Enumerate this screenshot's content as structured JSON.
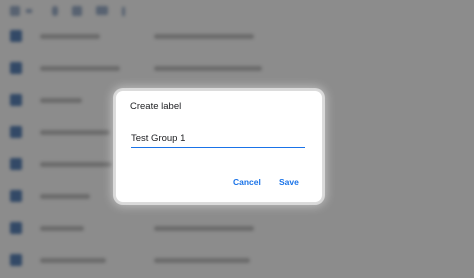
{
  "dialog": {
    "title": "Create label",
    "input_value": "Test Group 1",
    "cancel_label": "Cancel",
    "save_label": "Save"
  },
  "colors": {
    "accent": "#1a73e8",
    "scrim": "rgba(0,0,0,0.42)",
    "dialog_bg": "#ffffff"
  }
}
